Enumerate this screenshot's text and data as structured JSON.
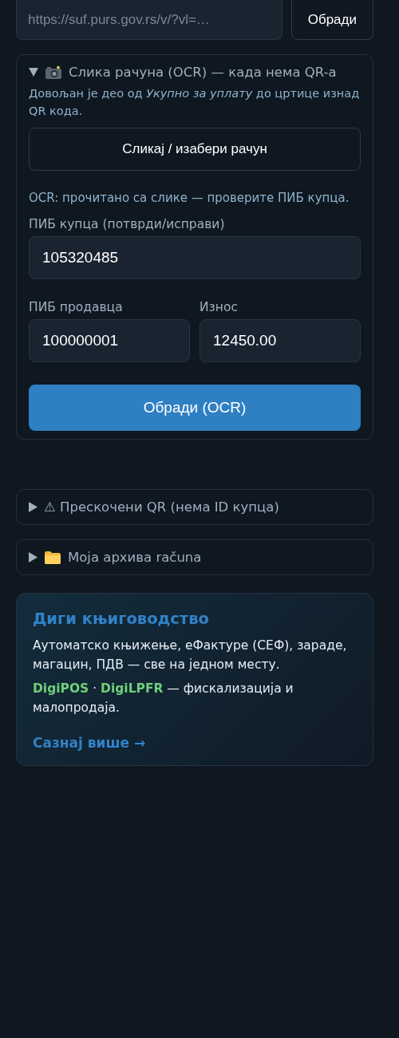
{
  "url_bar": {
    "placeholder": "https://suf.purs.gov.rs/v/?vl=…",
    "button": "Обради"
  },
  "sections": [
    {
      "title": "Слика рачуна (OCR) — када нема QR-a",
      "expanded": true,
      "hint": "Довољан је део од *Укупно за уплату* до цртице изнад QR кода.",
      "pick_button": "Сликај / изабери рачун",
      "status": "OCR: прочитано са слике — проверите ПИБ купца.",
      "buyer": {
        "label": "ПИБ купца (потврди/исправи)",
        "value": "105320485"
      },
      "seller": {
        "label": "ПИБ продавца",
        "value": "100000001"
      },
      "amount": {
        "label": "Износ",
        "value": "12450.00"
      },
      "submit": "Обради (OCR)"
    },
    {
      "title": "⚠ Прескочени QR (нема ID купца)",
      "expanded": false
    },
    {
      "title": "Моја архива računa",
      "expanded": false
    }
  ],
  "promo": {
    "title": "Диги књиговодство",
    "text": "Аутоматско књижење, еФактуре (СЕФ), зараде, магацин, ПДВ — све на једном месту.",
    "products": "**DigiPOS** · **DigiLPFR** — фискализација и малопродаја.",
    "link": "Сазнај више →"
  }
}
